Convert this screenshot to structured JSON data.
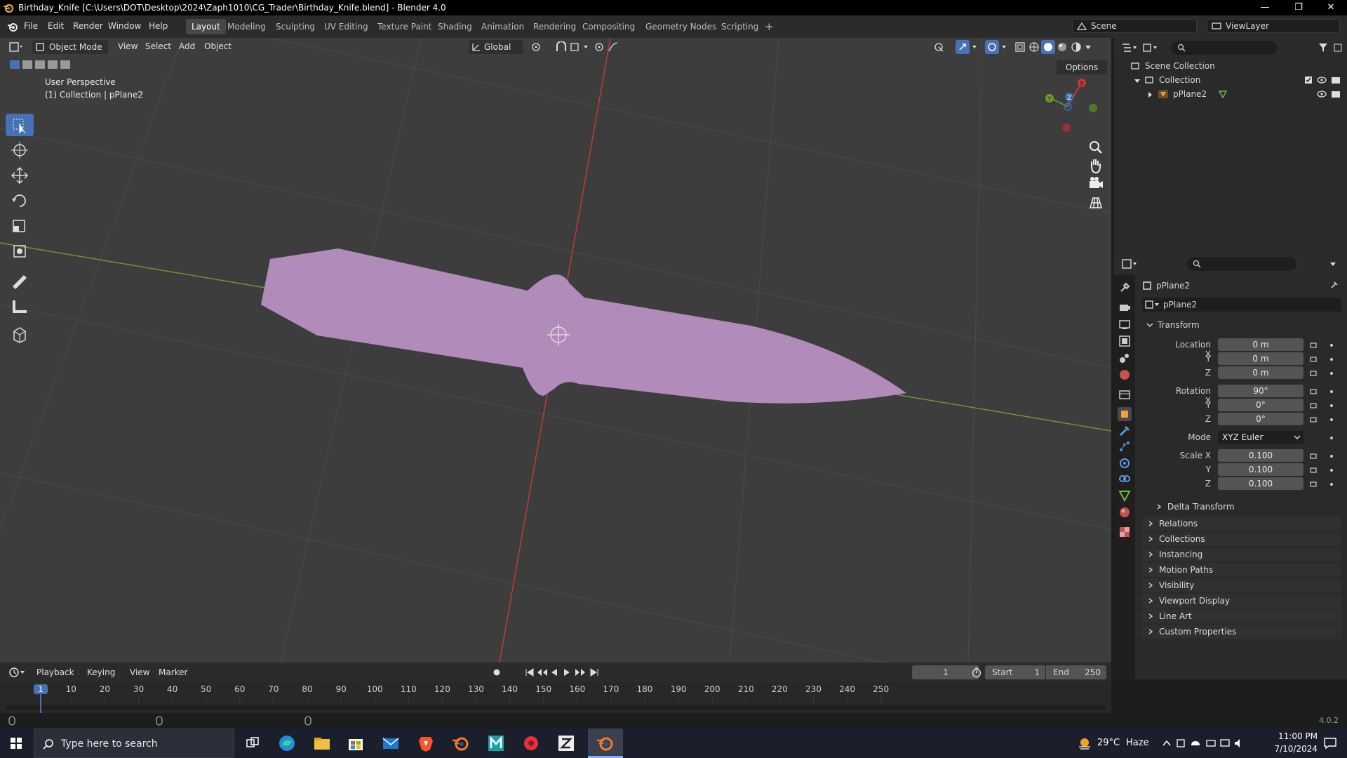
{
  "titlebar": {
    "title": "Birthday_Knife [C:\\Users\\DOT\\Desktop\\2024\\Zaph1010\\CG_Trader\\Birthday_Knife.blend] - Blender 4.0",
    "minimize": "—",
    "maximize": "❐",
    "close": "✕"
  },
  "menu": {
    "file": "File",
    "edit": "Edit",
    "render": "Render",
    "window": "Window",
    "help": "Help"
  },
  "workspaces": [
    "Layout",
    "Modeling",
    "Sculpting",
    "UV Editing",
    "Texture Paint",
    "Shading",
    "Animation",
    "Rendering",
    "Compositing",
    "Geometry Nodes",
    "Scripting"
  ],
  "add_workspace": "+",
  "scene": {
    "scene_name": "Scene",
    "view_layer": "ViewLayer"
  },
  "viewport": {
    "mode": "Object Mode",
    "menu_view": "View",
    "menu_select": "Select",
    "menu_add": "Add",
    "menu_object": "Object",
    "orientation": "Global",
    "options": "Options",
    "perspective": "User Perspective",
    "collection_info": "(1) Collection | pPlane2",
    "gizmo": {
      "x": "X",
      "y": "Y",
      "z": "Z"
    }
  },
  "outliner": {
    "root": "Scene Collection",
    "collection": "Collection",
    "object": "pPlane2"
  },
  "properties": {
    "object_name": "pPlane2",
    "data_name": "pPlane2",
    "transform_header": "Transform",
    "location": {
      "label_x": "Location X",
      "label_y": "Y",
      "label_z": "Z",
      "x": "0 m",
      "y": "0 m",
      "z": "0 m"
    },
    "rotation": {
      "label_x": "Rotation X",
      "label_y": "Y",
      "label_z": "Z",
      "x": "90°",
      "y": "0°",
      "z": "0°"
    },
    "mode_label": "Mode",
    "mode": "XYZ Euler",
    "scale": {
      "label_x": "Scale X",
      "label_y": "Y",
      "label_z": "Z",
      "x": "0.100",
      "y": "0.100",
      "z": "0.100"
    },
    "delta": "Delta Transform",
    "panels": [
      "Relations",
      "Collections",
      "Instancing",
      "Motion Paths",
      "Visibility",
      "Viewport Display",
      "Line Art",
      "Custom Properties"
    ]
  },
  "timeline": {
    "playback": "Playback",
    "keying": "Keying",
    "view": "View",
    "marker": "Marker",
    "current_frame": "1",
    "start_label": "Start",
    "start": "1",
    "end_label": "End",
    "end": "250",
    "ticks": [
      "1",
      "10",
      "20",
      "30",
      "40",
      "50",
      "60",
      "70",
      "80",
      "90",
      "100",
      "110",
      "120",
      "130",
      "140",
      "150",
      "160",
      "170",
      "180",
      "190",
      "200",
      "210",
      "220",
      "230",
      "240",
      "250"
    ]
  },
  "statusbar": {
    "version": "4.0.2"
  },
  "taskbar": {
    "search_placeholder": "Type here to search",
    "weather_temp": "29°C",
    "weather_desc": "Haze",
    "time": "11:00 PM",
    "date": "7/10/2024"
  },
  "colors": {
    "knife": "#b18bb9",
    "accent": "#4772b3",
    "x_axis": "#c83a3a",
    "y_axis": "#6f9a2d"
  }
}
